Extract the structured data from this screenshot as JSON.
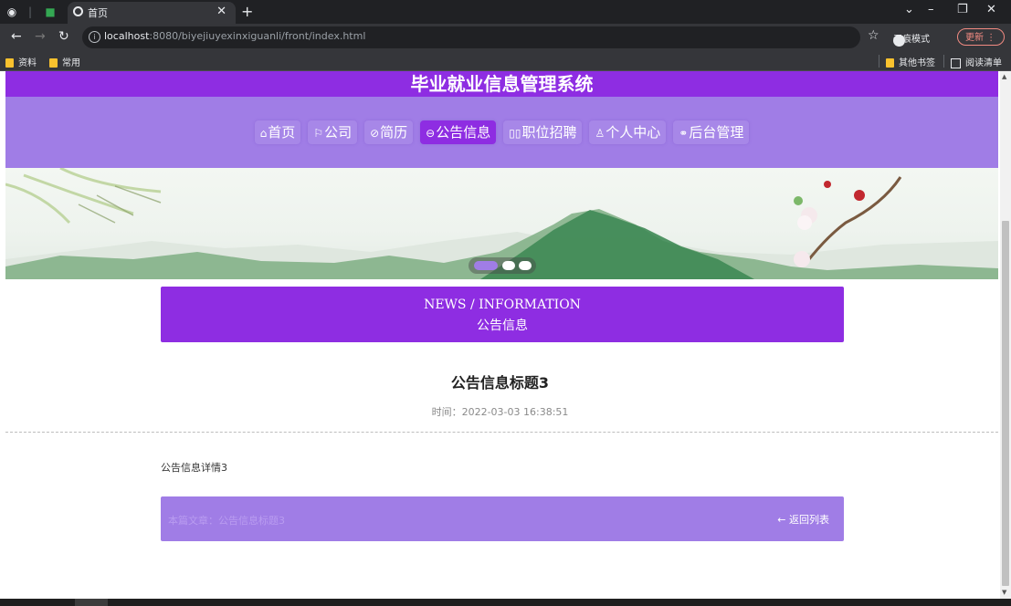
{
  "browser": {
    "tab_title": "首页",
    "url_host": "localhost",
    "url_rest": ":8080/biyejiuyexinxiguanli/front/index.html",
    "incognito_label": "无痕模式",
    "update_label": "更新",
    "bookmarks": [
      "资料",
      "常用"
    ],
    "other_bookmarks": "其他书签",
    "reading_list": "阅读清单"
  },
  "site": {
    "title": "毕业就业信息管理系统",
    "nav": [
      {
        "icon": "⌂",
        "label": "首页",
        "active": false
      },
      {
        "icon": "⚐",
        "label": "公司",
        "active": false
      },
      {
        "icon": "⊘",
        "label": "简历",
        "active": false
      },
      {
        "icon": "⊖",
        "label": "公告信息",
        "active": true
      },
      {
        "icon": "▯▯",
        "label": "职位招聘",
        "active": false
      },
      {
        "icon": "♙",
        "label": "个人中心",
        "active": false
      },
      {
        "icon": "⚭",
        "label": "后台管理",
        "active": false
      }
    ]
  },
  "news_header": {
    "en": "NEWS / INFORMATION",
    "cn": "公告信息"
  },
  "detail": {
    "title": "公告信息标题3",
    "time": "时间：2022-03-03 16:38:51",
    "content": "公告信息详情3"
  },
  "footer": {
    "current_article": "本篇文章：公告信息标题3",
    "back_label": "返回列表"
  },
  "colors": {
    "primary": "#8e2de2",
    "nav_bg": "#a07de6"
  }
}
